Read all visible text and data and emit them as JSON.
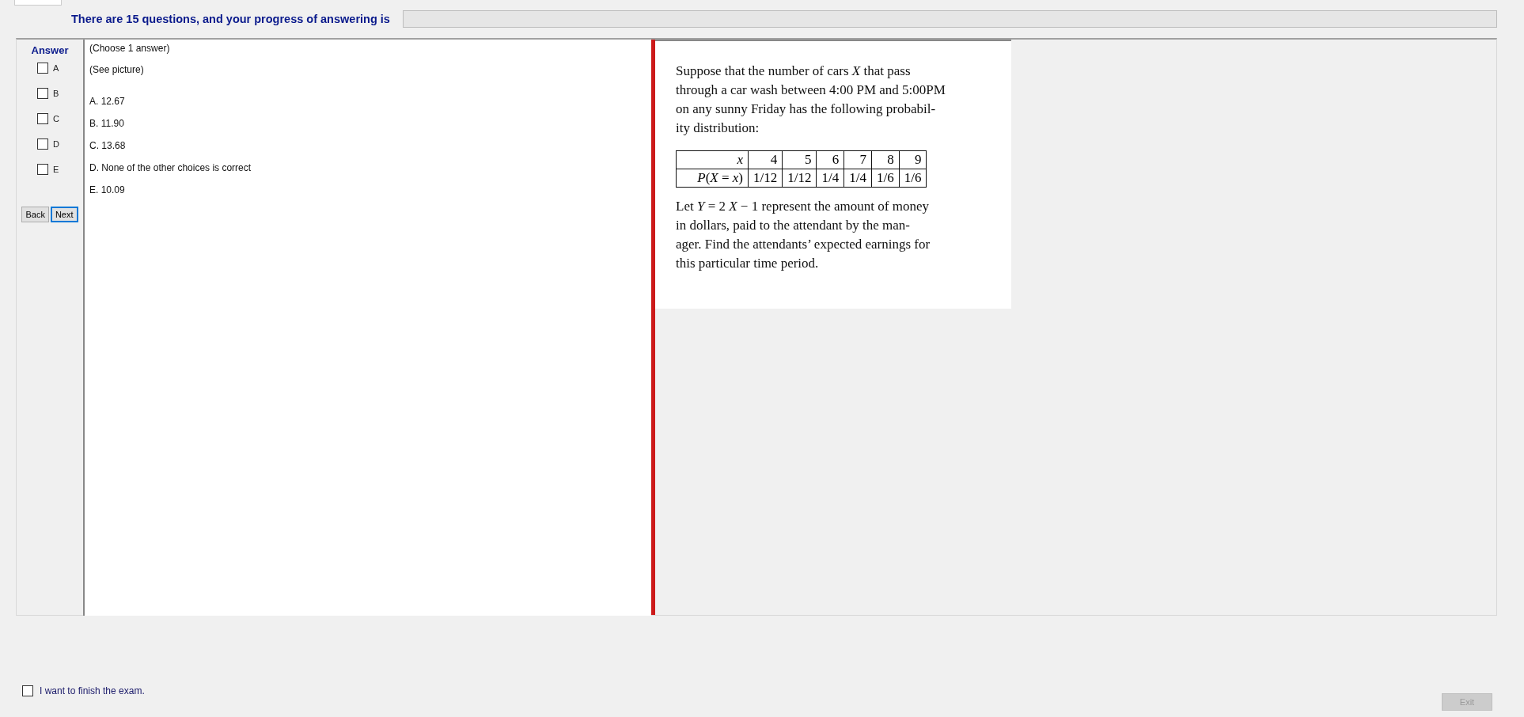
{
  "header": {
    "text": "There are 15 questions, and your progress of answering is",
    "progress": {
      "level": 0
    }
  },
  "answer_panel": {
    "title": "Answer",
    "options": [
      {
        "label": "A",
        "checked": false
      },
      {
        "label": "B",
        "checked": false
      },
      {
        "label": "C",
        "checked": false
      },
      {
        "label": "D",
        "checked": false
      },
      {
        "label": "E",
        "checked": false
      }
    ],
    "buttons": [
      {
        "label": "Back",
        "selected": false
      },
      {
        "label": "Next",
        "selected": true
      }
    ]
  },
  "question": {
    "lines": [
      "(Choose 1 answer)",
      "(See picture)"
    ],
    "choices": [
      "A.  12.67",
      "B.  11.90",
      "C.  13.68",
      "D.  None of the other choices is correct",
      "E.  10.09"
    ]
  },
  "picture_document": {
    "intro": "Suppose that the number of cars *X* that pass\nthrough a car wash between 4:00 PM and 5:00PM\non any sunny Friday has the following probabil-\nity distribution:",
    "table": [
      [
        "*x*",
        "4",
        "5",
        "6",
        "7",
        "8",
        "9"
      ],
      [
        "*P*(*X* = *x*)",
        "1/12",
        "1/12",
        "1/4",
        "1/4",
        "1/6",
        "1/6"
      ]
    ],
    "outro": "Let *Y* = 2 *X* − 1 represent the amount of money\nin dollars, paid to the attendant by the man-\nager. Find the attendants’ expected earnings for\nthis particular time period."
  },
  "finish": {
    "label": "I want to finish the exam.",
    "checked": false
  },
  "exit_button": {
    "label": "Exit",
    "disabled": true
  }
}
